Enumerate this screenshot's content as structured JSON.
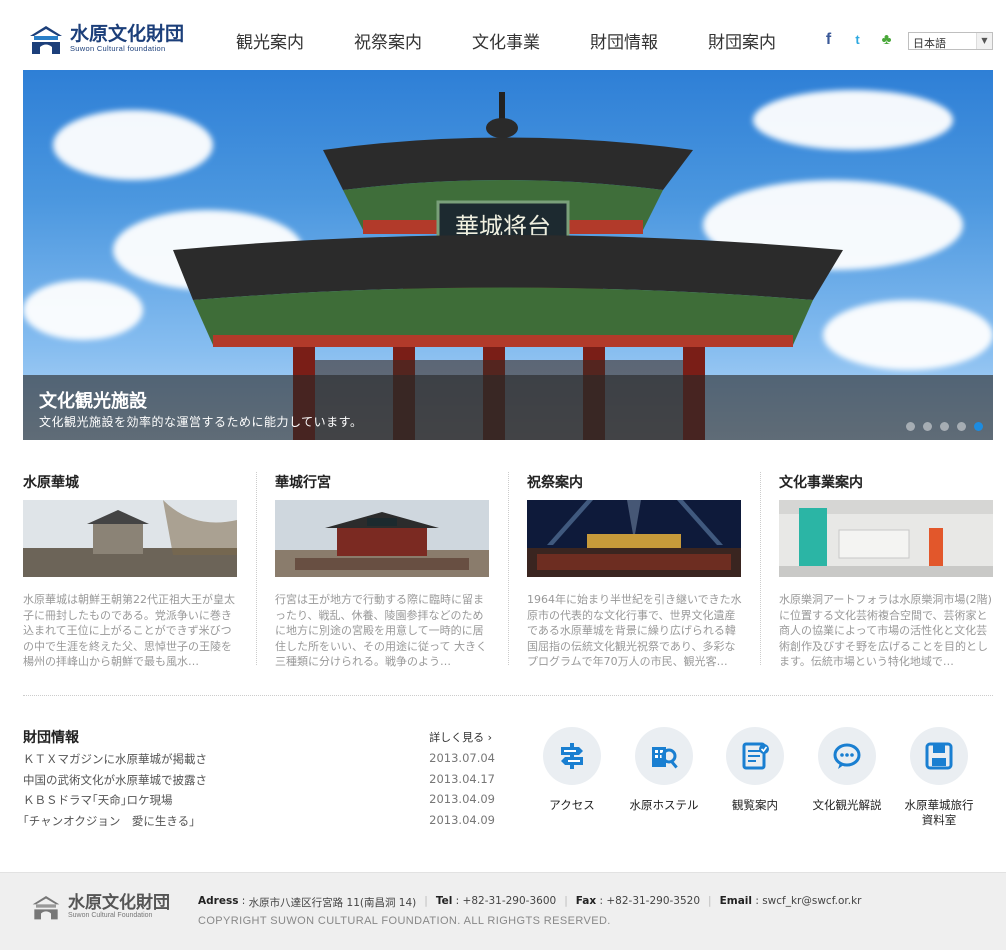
{
  "header": {
    "logo_name": "水原文化財団",
    "logo_sub": "Suwon Cultural foundation",
    "nav": [
      "観光案内",
      "祝祭案内",
      "文化事業",
      "財団情報",
      "財団案内"
    ],
    "sns": {
      "facebook": "f",
      "twitter": "t",
      "me2day": "♣"
    },
    "language": "日本語"
  },
  "hero": {
    "title": "文化観光施設",
    "subtitle": "文化観光施設を効率的な運営するために能力しています。",
    "signboard": "華城将台",
    "slides_total": 5,
    "active_slide": 5
  },
  "cards": [
    {
      "title": "水原華城",
      "text": "水原華城は朝鮮王朝第22代正祖大王が皇太子に冊封したものである。党派争いに巻き込まれて王位に上がることができず米びつの中で生涯を終えた父、思悼世子の王陵を楊州の拝峰山から朝鮮で最も風水…"
    },
    {
      "title": "華城行宮",
      "text": "行宮は王が地方で行動する際に臨時に留まったり、戦乱、休養、陵園参拝などのために地方に別途の宮殿を用意して一時的に居住した所をいい、その用途に従って 大きく三種類に分けられる。戦争のよう…"
    },
    {
      "title": "祝祭案内",
      "text": "1964年に始まり半世紀を引き継いできた水原市の代表的な文化行事で、世界文化遺産である水原華城を背景に繰り広げられる韓国屈指の伝統文化観光祝祭であり、多彩なプログラムで年70万人の市民、観光客…"
    },
    {
      "title": "文化事業案内",
      "text": "水原樂洞アートフォラは水原樂洞市場(2階)に位置する文化芸術複合空間で、芸術家と商人の協業によって市場の活性化と文化芸術創作及びすそ野を広げることを目的とします。伝統市場という特化地域で…"
    }
  ],
  "news": {
    "title": "財団情報",
    "more": "詳しく見る",
    "items": [
      {
        "text": "ＫＴＸマガジンに水原華城が掲載さ",
        "date": "2013.07.04"
      },
      {
        "text": "中国の武術文化が水原華城で披露さ",
        "date": "2013.04.17"
      },
      {
        "text": "ＫＢＳドラマ｢天命｣ロケ現場",
        "date": "2013.04.09"
      },
      {
        "text": "｢チャンオクジョン　愛に生きる｣",
        "date": "2013.04.09"
      }
    ]
  },
  "quick": [
    {
      "label": "アクセス",
      "icon": "signpost-icon"
    },
    {
      "label": "水原ホステル",
      "icon": "building-search-icon"
    },
    {
      "label": "観覧案内",
      "icon": "document-check-icon"
    },
    {
      "label": "文化観光解説",
      "icon": "speech-bubble-icon"
    },
    {
      "label": "水原華城旅行\n資料室",
      "icon": "save-disk-icon"
    }
  ],
  "footer": {
    "logo_name": "水原文化財団",
    "logo_sub": "Suwon Cultural Foundation",
    "address_label": "Adress",
    "address": "水原市八達区行宮路 11(南昌洞 14)",
    "tel_label": "Tel",
    "tel": "+82-31-290-3600",
    "fax_label": "Fax",
    "fax": "+82-31-290-3520",
    "email_label": "Email",
    "email": "swcf_kr@swcf.or.kr",
    "copyright": "COPYRIGHT SUWON CULTURAL FOUNDATION. ALL RIGHGTS RESERVED."
  },
  "colors": {
    "brand": "#1c3f7a",
    "accent_dot": "#1d8ce0",
    "quick_circle": "#eaeef2",
    "quick_icon": "#1a7fd1"
  }
}
